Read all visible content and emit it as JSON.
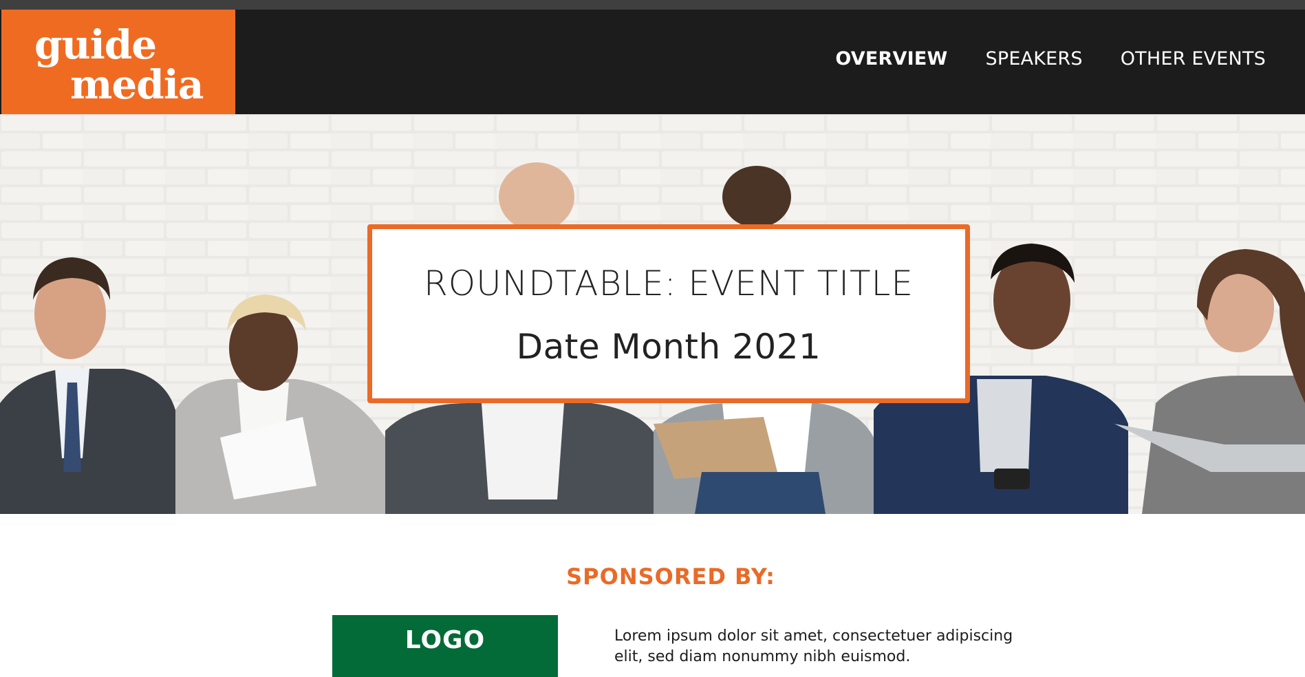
{
  "brand": {
    "line1": "guide",
    "line2": "media",
    "color": "#f06b22"
  },
  "nav": {
    "items": [
      {
        "label": "OVERVIEW",
        "active": true
      },
      {
        "label": "SPEAKERS",
        "active": false
      },
      {
        "label": "OTHER EVENTS",
        "active": false
      }
    ]
  },
  "hero": {
    "title": "ROUNDTABLE: EVENT TITLE",
    "date": "Date Month 2021",
    "accent_color": "#ea6a27"
  },
  "sponsors": {
    "heading": "SPONSORED BY:",
    "logo_label": "LOGO",
    "logo_color": "#036b37",
    "description": "Lorem ipsum dolor sit amet, consectetuer adipiscing elit, sed diam nonummy nibh euismod."
  }
}
